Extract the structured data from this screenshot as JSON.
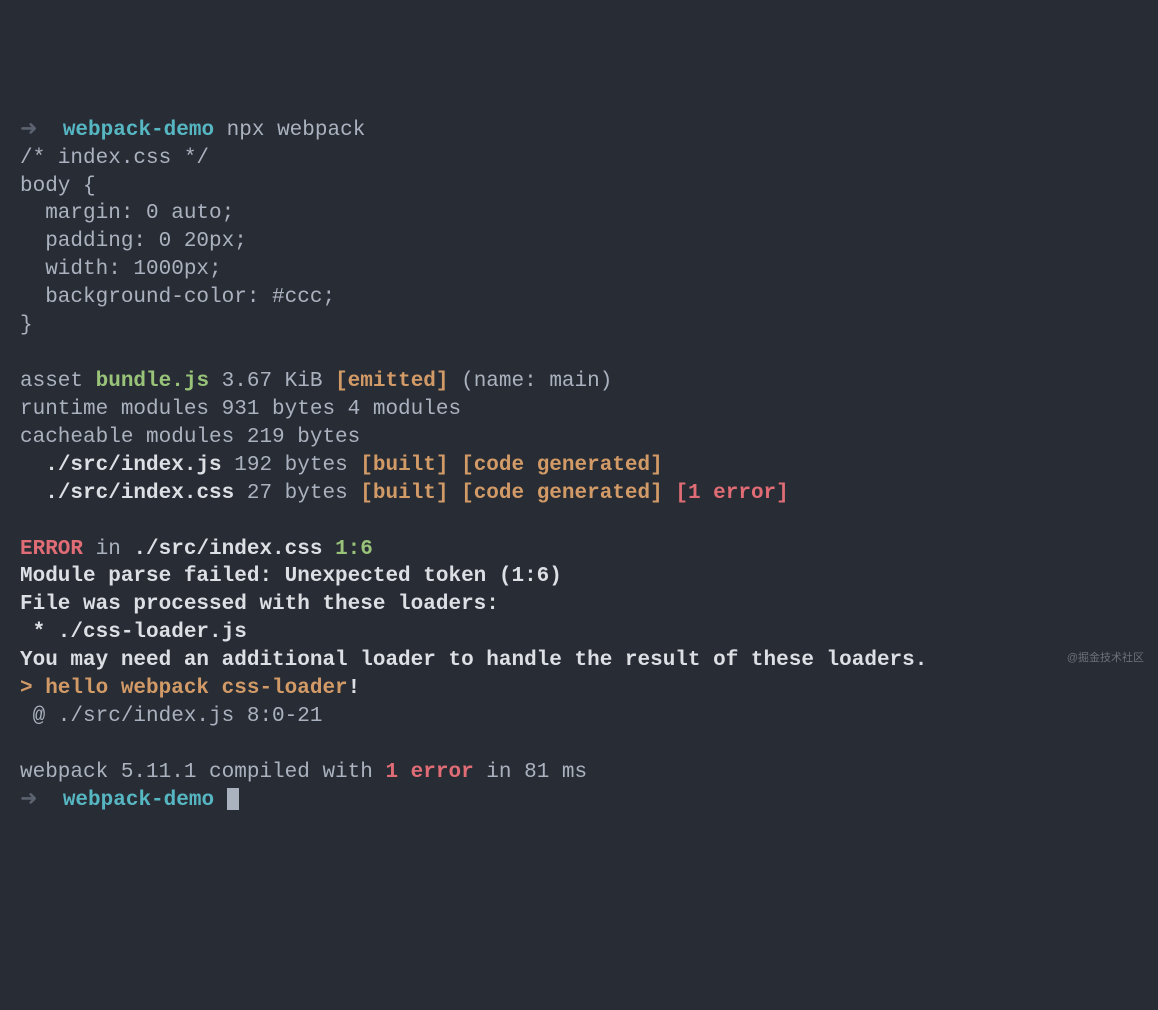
{
  "prompt": {
    "arrow": "➜",
    "dir": "webpack-demo",
    "command": "npx webpack"
  },
  "css": {
    "l1": "/* index.css */",
    "l2": "body {",
    "l3": "  margin: 0 auto;",
    "l4": "  padding: 0 20px;",
    "l5": "  width: 1000px;",
    "l6": "  background-color: #ccc;",
    "l7": "}"
  },
  "asset": {
    "prefix": "asset ",
    "name": "bundle.js",
    "size": " 3.67 KiB ",
    "tag": "[emitted]",
    "suffix": " (name: main)"
  },
  "runtime": "runtime modules 931 bytes 4 modules",
  "cacheable": "cacheable modules 219 bytes",
  "mod1": {
    "indent": "  ",
    "path": "./src/index.js",
    "size": " 192 bytes ",
    "tag": "[built] [code generated]"
  },
  "mod2": {
    "indent": "  ",
    "path": "./src/index.css",
    "size": " 27 bytes ",
    "tag": "[built] [code generated]",
    "err": " [1 error]"
  },
  "error": {
    "label": "ERROR",
    "in_txt": " in ",
    "file": "./src/index.css",
    "loc": " 1:6",
    "l1": "Module parse failed: Unexpected token (1:6)",
    "l2": "File was processed with these loaders:",
    "l3": " * ./css-loader.js",
    "l4": "You may need an additional loader to handle the result of these loaders.",
    "l5_pre": "> hello webpack css-loader",
    "l5_excl": "!",
    "l6": " @ ./src/index.js 8:0-21"
  },
  "summary": {
    "pre": "webpack 5.11.1 compiled with ",
    "err": "1 error",
    "post": " in 81 ms"
  },
  "watermark": "@掘金技术社区"
}
